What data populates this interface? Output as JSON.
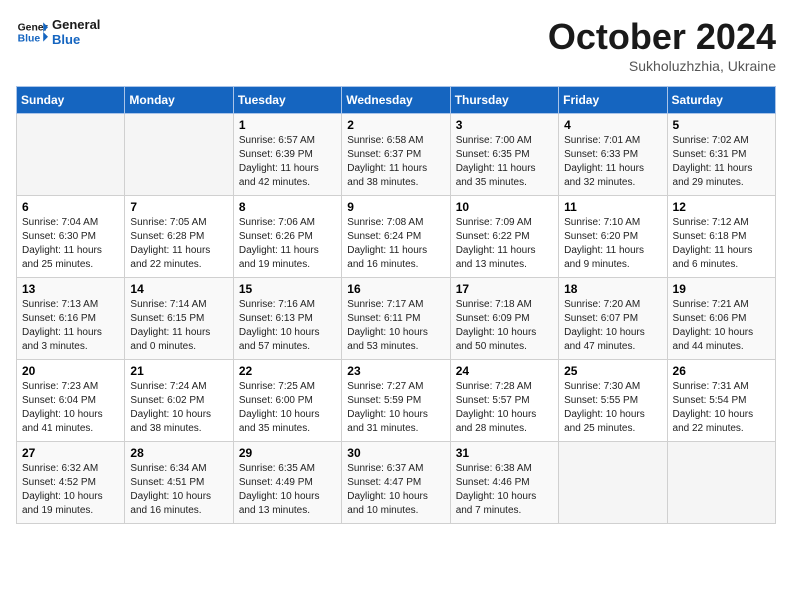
{
  "header": {
    "logo_line1": "General",
    "logo_line2": "Blue",
    "month_title": "October 2024",
    "subtitle": "Sukholuzhzhia, Ukraine"
  },
  "weekdays": [
    "Sunday",
    "Monday",
    "Tuesday",
    "Wednesday",
    "Thursday",
    "Friday",
    "Saturday"
  ],
  "weeks": [
    [
      {
        "day": "",
        "info": ""
      },
      {
        "day": "",
        "info": ""
      },
      {
        "day": "1",
        "info": "Sunrise: 6:57 AM\nSunset: 6:39 PM\nDaylight: 11 hours and 42 minutes."
      },
      {
        "day": "2",
        "info": "Sunrise: 6:58 AM\nSunset: 6:37 PM\nDaylight: 11 hours and 38 minutes."
      },
      {
        "day": "3",
        "info": "Sunrise: 7:00 AM\nSunset: 6:35 PM\nDaylight: 11 hours and 35 minutes."
      },
      {
        "day": "4",
        "info": "Sunrise: 7:01 AM\nSunset: 6:33 PM\nDaylight: 11 hours and 32 minutes."
      },
      {
        "day": "5",
        "info": "Sunrise: 7:02 AM\nSunset: 6:31 PM\nDaylight: 11 hours and 29 minutes."
      }
    ],
    [
      {
        "day": "6",
        "info": "Sunrise: 7:04 AM\nSunset: 6:30 PM\nDaylight: 11 hours and 25 minutes."
      },
      {
        "day": "7",
        "info": "Sunrise: 7:05 AM\nSunset: 6:28 PM\nDaylight: 11 hours and 22 minutes."
      },
      {
        "day": "8",
        "info": "Sunrise: 7:06 AM\nSunset: 6:26 PM\nDaylight: 11 hours and 19 minutes."
      },
      {
        "day": "9",
        "info": "Sunrise: 7:08 AM\nSunset: 6:24 PM\nDaylight: 11 hours and 16 minutes."
      },
      {
        "day": "10",
        "info": "Sunrise: 7:09 AM\nSunset: 6:22 PM\nDaylight: 11 hours and 13 minutes."
      },
      {
        "day": "11",
        "info": "Sunrise: 7:10 AM\nSunset: 6:20 PM\nDaylight: 11 hours and 9 minutes."
      },
      {
        "day": "12",
        "info": "Sunrise: 7:12 AM\nSunset: 6:18 PM\nDaylight: 11 hours and 6 minutes."
      }
    ],
    [
      {
        "day": "13",
        "info": "Sunrise: 7:13 AM\nSunset: 6:16 PM\nDaylight: 11 hours and 3 minutes."
      },
      {
        "day": "14",
        "info": "Sunrise: 7:14 AM\nSunset: 6:15 PM\nDaylight: 11 hours and 0 minutes."
      },
      {
        "day": "15",
        "info": "Sunrise: 7:16 AM\nSunset: 6:13 PM\nDaylight: 10 hours and 57 minutes."
      },
      {
        "day": "16",
        "info": "Sunrise: 7:17 AM\nSunset: 6:11 PM\nDaylight: 10 hours and 53 minutes."
      },
      {
        "day": "17",
        "info": "Sunrise: 7:18 AM\nSunset: 6:09 PM\nDaylight: 10 hours and 50 minutes."
      },
      {
        "day": "18",
        "info": "Sunrise: 7:20 AM\nSunset: 6:07 PM\nDaylight: 10 hours and 47 minutes."
      },
      {
        "day": "19",
        "info": "Sunrise: 7:21 AM\nSunset: 6:06 PM\nDaylight: 10 hours and 44 minutes."
      }
    ],
    [
      {
        "day": "20",
        "info": "Sunrise: 7:23 AM\nSunset: 6:04 PM\nDaylight: 10 hours and 41 minutes."
      },
      {
        "day": "21",
        "info": "Sunrise: 7:24 AM\nSunset: 6:02 PM\nDaylight: 10 hours and 38 minutes."
      },
      {
        "day": "22",
        "info": "Sunrise: 7:25 AM\nSunset: 6:00 PM\nDaylight: 10 hours and 35 minutes."
      },
      {
        "day": "23",
        "info": "Sunrise: 7:27 AM\nSunset: 5:59 PM\nDaylight: 10 hours and 31 minutes."
      },
      {
        "day": "24",
        "info": "Sunrise: 7:28 AM\nSunset: 5:57 PM\nDaylight: 10 hours and 28 minutes."
      },
      {
        "day": "25",
        "info": "Sunrise: 7:30 AM\nSunset: 5:55 PM\nDaylight: 10 hours and 25 minutes."
      },
      {
        "day": "26",
        "info": "Sunrise: 7:31 AM\nSunset: 5:54 PM\nDaylight: 10 hours and 22 minutes."
      }
    ],
    [
      {
        "day": "27",
        "info": "Sunrise: 6:32 AM\nSunset: 4:52 PM\nDaylight: 10 hours and 19 minutes."
      },
      {
        "day": "28",
        "info": "Sunrise: 6:34 AM\nSunset: 4:51 PM\nDaylight: 10 hours and 16 minutes."
      },
      {
        "day": "29",
        "info": "Sunrise: 6:35 AM\nSunset: 4:49 PM\nDaylight: 10 hours and 13 minutes."
      },
      {
        "day": "30",
        "info": "Sunrise: 6:37 AM\nSunset: 4:47 PM\nDaylight: 10 hours and 10 minutes."
      },
      {
        "day": "31",
        "info": "Sunrise: 6:38 AM\nSunset: 4:46 PM\nDaylight: 10 hours and 7 minutes."
      },
      {
        "day": "",
        "info": ""
      },
      {
        "day": "",
        "info": ""
      }
    ]
  ]
}
